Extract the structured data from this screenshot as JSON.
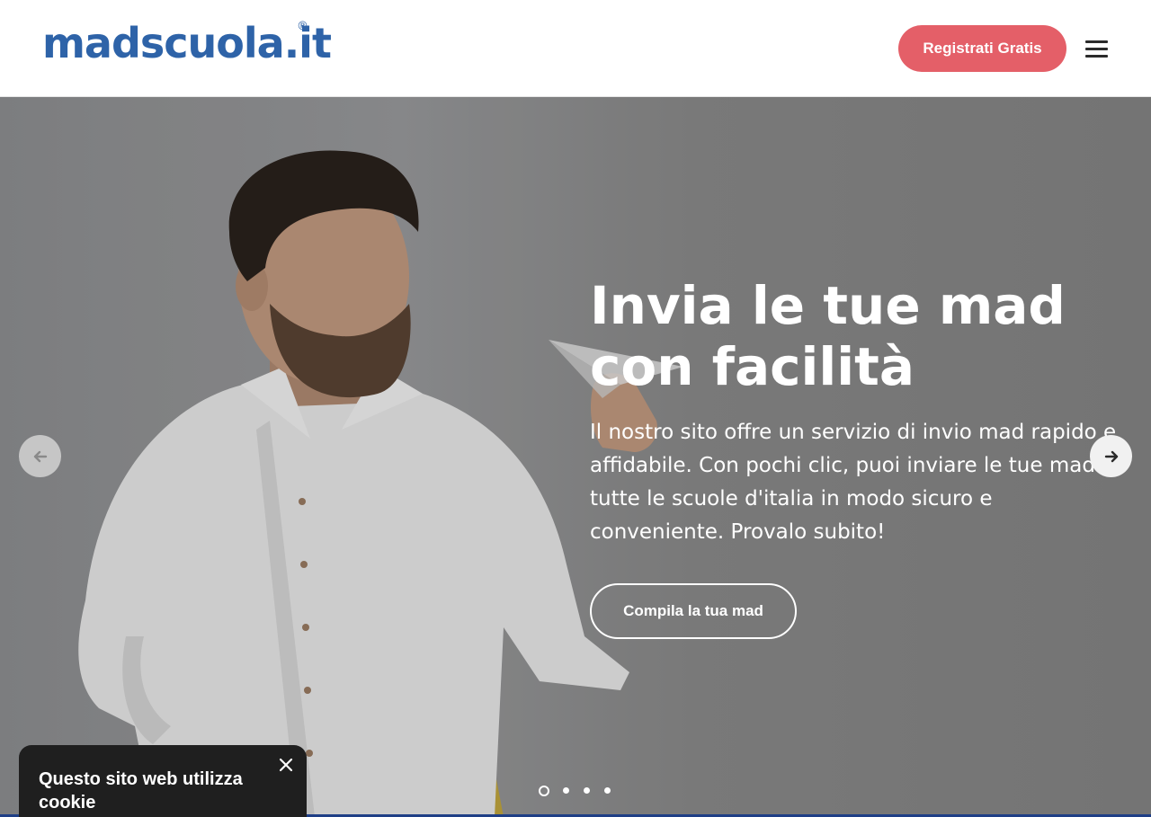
{
  "header": {
    "logo_text": "madscuola.it",
    "logo_registered": "®",
    "register_button": "Registrati Gratis",
    "menu_icon": "hamburger-menu-icon"
  },
  "hero": {
    "title": "Invia le tue mad con facilità",
    "description": "Il nostro sito offre un servizio di invio mad rapido e affidabile. Con pochi clic, puoi inviare le tue mad a tutte le scuole d'italia in modo sicuro e conveniente. Provalo subito!",
    "cta_button": "Compila la tua mad",
    "prev_icon": "arrow-left-icon",
    "next_icon": "arrow-right-icon",
    "slides_count": 4,
    "active_slide": 1
  },
  "cookie_banner": {
    "text": "Questo sito web utilizza cookie",
    "close_icon": "close-icon"
  },
  "colors": {
    "brand_blue": "#2e63a8",
    "register_button": "#e45f68",
    "cookie_background": "#1f1f1f"
  }
}
